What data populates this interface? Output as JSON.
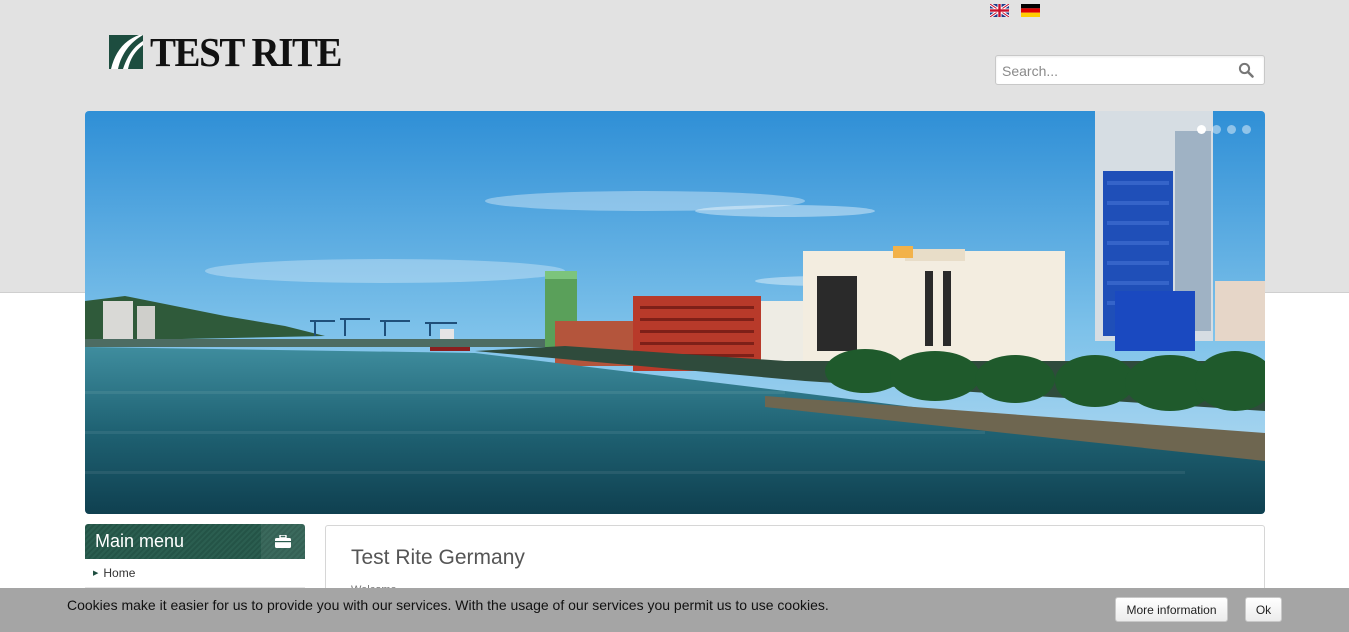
{
  "header": {
    "logo_text": "TEST RITE",
    "languages": [
      {
        "code": "en",
        "icon": "uk-flag-icon"
      },
      {
        "code": "de",
        "icon": "germany-flag-icon"
      }
    ]
  },
  "search": {
    "placeholder": "Search...",
    "icon": "search-icon"
  },
  "slider": {
    "dot_count": 4,
    "active_index": 0
  },
  "main_menu": {
    "title": "Main menu",
    "icon": "briefcase-icon",
    "items": [
      {
        "label": "Home"
      }
    ]
  },
  "content": {
    "title": "Test Rite Germany",
    "subtitle": "Welcome"
  },
  "cookie_bar": {
    "message": "Cookies make it easier for us to provide you with our services. With the usage of our services you permit us to use cookies.",
    "more_label": "More information",
    "ok_label": "Ok"
  },
  "colors": {
    "brand_green": "#1d4d3f",
    "header_bg": "#e2e2e2",
    "cookie_bg": "#a5a5a5"
  }
}
